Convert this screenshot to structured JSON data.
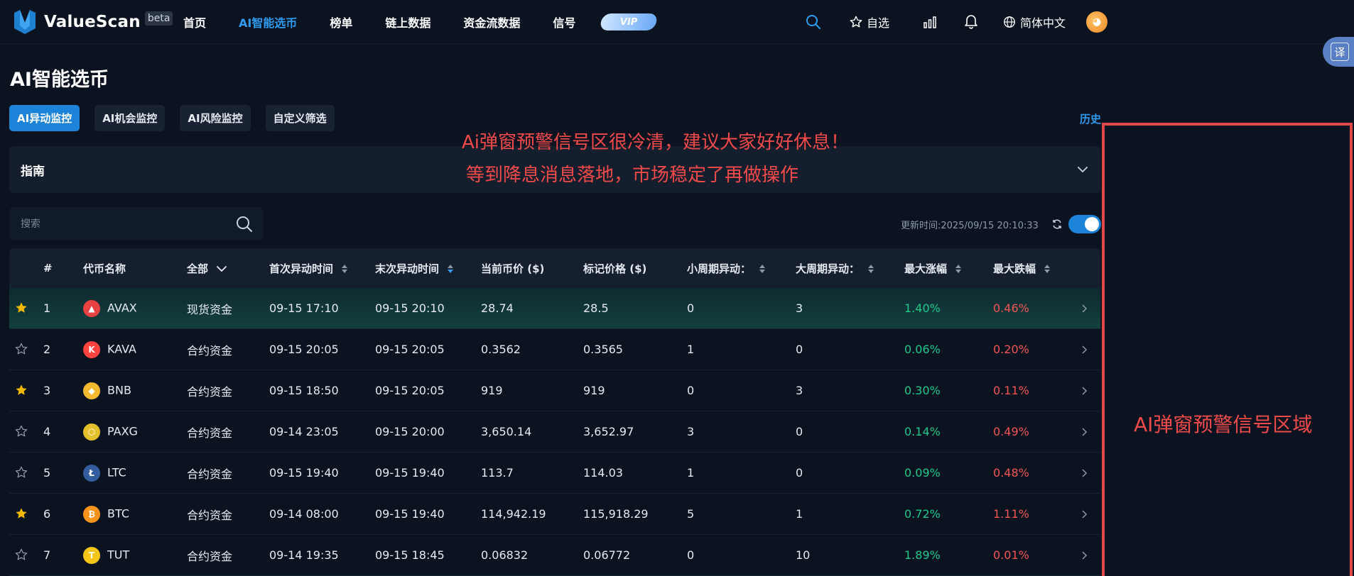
{
  "brand": {
    "name": "ValueScan",
    "badge": "beta"
  },
  "nav": {
    "items": [
      {
        "label": "首页",
        "active": false
      },
      {
        "label": "AI智能选币",
        "active": true
      },
      {
        "label": "榜单",
        "active": false
      },
      {
        "label": "链上数据",
        "active": false
      },
      {
        "label": "资金流数据",
        "active": false
      },
      {
        "label": "信号",
        "active": false
      }
    ],
    "vip_label": "VIP"
  },
  "top_right": {
    "watchlist_label": "自选",
    "language_label": "简体中文",
    "translate_label": "译"
  },
  "page": {
    "title": "AI智能选币",
    "history_label": "历史"
  },
  "tabs": [
    {
      "label": "AI异动监控",
      "active": true
    },
    {
      "label": "AI机会监控",
      "active": false
    },
    {
      "label": "AI风险监控",
      "active": false
    },
    {
      "label": "自定义筛选",
      "active": false
    }
  ],
  "guide": {
    "label": "指南"
  },
  "search": {
    "placeholder": "搜索",
    "value": ""
  },
  "update": {
    "text": "更新时间:2025/09/15 20:10:33",
    "auto_refresh_on": true
  },
  "table": {
    "headers": {
      "index": "#",
      "name": "代币名称",
      "filter": "全部",
      "first_time": "首次异动时间",
      "last_time": "末次异动时间",
      "price": "当前币价 ($)",
      "mark_price": "标记价格 ($)",
      "short_cycle": "小周期异动：",
      "long_cycle": "大周期异动：",
      "max_rise": "最大涨幅",
      "max_fall": "最大跌幅"
    },
    "rows": [
      {
        "starred": true,
        "index": "1",
        "symbol": "AVAX",
        "logo_color": "#e84142",
        "logo_glyph": "▲",
        "type": "现货资金",
        "first": "09-15 17:10",
        "last": "09-15 20:10",
        "price": "28.74",
        "mark": "28.5",
        "short": "0",
        "long": "3",
        "rise": "1.40%",
        "fall": "0.46%"
      },
      {
        "starred": false,
        "index": "2",
        "symbol": "KAVA",
        "logo_color": "#ff433e",
        "logo_glyph": "K",
        "type": "合约资金",
        "first": "09-15 20:05",
        "last": "09-15 20:05",
        "price": "0.3562",
        "mark": "0.3565",
        "short": "1",
        "long": "0",
        "rise": "0.06%",
        "fall": "0.20%"
      },
      {
        "starred": true,
        "index": "3",
        "symbol": "BNB",
        "logo_color": "#f3ba2f",
        "logo_glyph": "◆",
        "type": "合约资金",
        "first": "09-15 18:50",
        "last": "09-15 20:05",
        "price": "919",
        "mark": "919",
        "short": "0",
        "long": "3",
        "rise": "0.30%",
        "fall": "0.11%"
      },
      {
        "starred": false,
        "index": "4",
        "symbol": "PAXG",
        "logo_color": "#e4c02a",
        "logo_glyph": "⬡",
        "type": "合约资金",
        "first": "09-14 23:05",
        "last": "09-15 20:00",
        "price": "3,650.14",
        "mark": "3,652.97",
        "short": "3",
        "long": "0",
        "rise": "0.14%",
        "fall": "0.49%"
      },
      {
        "starred": false,
        "index": "5",
        "symbol": "LTC",
        "logo_color": "#345d9d",
        "logo_glyph": "Ł",
        "type": "合约资金",
        "first": "09-15 19:40",
        "last": "09-15 19:40",
        "price": "113.7",
        "mark": "114.03",
        "short": "1",
        "long": "0",
        "rise": "0.09%",
        "fall": "0.48%"
      },
      {
        "starred": true,
        "index": "6",
        "symbol": "BTC",
        "logo_color": "#f7931a",
        "logo_glyph": "₿",
        "type": "合约资金",
        "first": "09-14 08:00",
        "last": "09-15 19:40",
        "price": "114,942.19",
        "mark": "115,918.29",
        "short": "5",
        "long": "1",
        "rise": "0.72%",
        "fall": "1.11%"
      },
      {
        "starred": false,
        "index": "7",
        "symbol": "TUT",
        "logo_color": "#f5c518",
        "logo_glyph": "T",
        "type": "合约资金",
        "first": "09-14 19:35",
        "last": "09-15 18:45",
        "price": "0.06832",
        "mark": "0.06772",
        "short": "0",
        "long": "10",
        "rise": "1.89%",
        "fall": "0.01%"
      }
    ]
  },
  "annotations": {
    "line1": "Ai弹窗预警信号区很冷清，建议大家好好休息！",
    "line2": "等到降息消息落地，市场稳定了再做操作",
    "box_label": "AI弹窗预警信号区域"
  },
  "colors": {
    "accent": "#1b84d8",
    "up": "#1ec98a",
    "down": "#f25555",
    "star": "#f5b800",
    "annotation": "#f04a4a"
  }
}
